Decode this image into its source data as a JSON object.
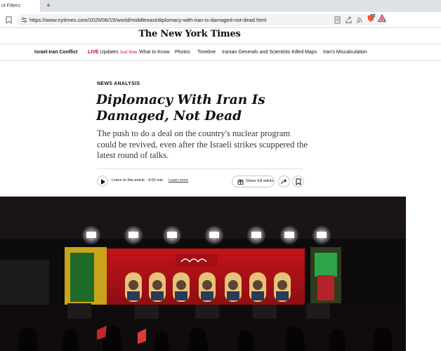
{
  "browser": {
    "tab_title": "nt Filters",
    "new_tab_icon": "plus-icon",
    "url": "https://www.nytimes.com/2025/06/15/world/middleeast/diplomacy-with-iran-is-damaged-not-dead.html",
    "brave_badge": "16",
    "colors": {
      "tabbar": "#dee1e6",
      "url_box": "#f1f3f4"
    }
  },
  "masthead": {
    "logo": "The New York Times"
  },
  "nav": {
    "brand": "Israel-Iran Conflict",
    "live": "LIVE",
    "updates": "Updates",
    "just_now": "Just Now",
    "items": [
      "What to Know",
      "Photos",
      "Timeline",
      "Iranian Generals and Scientists Killed",
      "Maps",
      "Iran's Miscalculation"
    ]
  },
  "article": {
    "kicker": "NEWS ANALYSIS",
    "headline": "Diplomacy With Iran Is Damaged, Not Dead",
    "summary": "The push to do a deal on the country's nuclear program could be revived, even after the Israeli strikes scuppered the latest round of talks.",
    "listen_label": "Listen to this article · 9:00 min",
    "learn_more": "Learn more",
    "share_label": "Share full article",
    "colors": {
      "live": "#d0021b",
      "text": "#121212"
    }
  }
}
